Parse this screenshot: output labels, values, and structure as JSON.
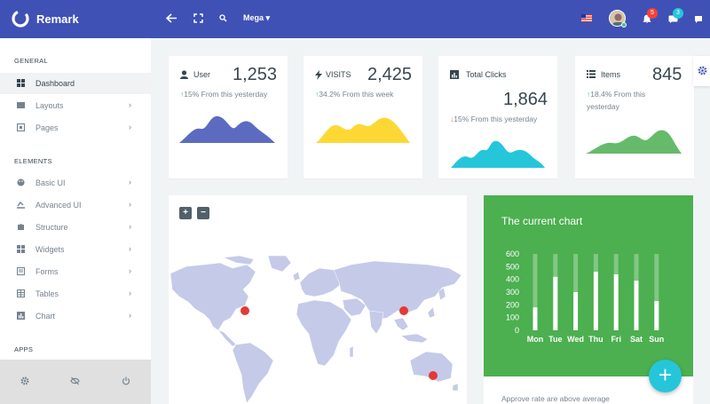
{
  "brand": {
    "name": "Remark"
  },
  "navbar": {
    "mega_label": "Mega",
    "badges": {
      "notifications": "5",
      "messages": "3"
    },
    "accent": "#3f51b5"
  },
  "sidebar": {
    "sections": [
      {
        "title": "GENERAL",
        "items": [
          {
            "label": "Dashboard",
            "icon": "dashboard-icon",
            "active": true,
            "arrow": false
          },
          {
            "label": "Layouts",
            "icon": "layouts-icon",
            "arrow": true
          },
          {
            "label": "Pages",
            "icon": "pages-icon",
            "arrow": true
          }
        ]
      },
      {
        "title": "ELEMENTS",
        "items": [
          {
            "label": "Basic UI",
            "icon": "palette-icon",
            "arrow": true
          },
          {
            "label": "Advanced UI",
            "icon": "advanced-icon",
            "arrow": true
          },
          {
            "label": "Structure",
            "icon": "puzzle-icon",
            "arrow": true
          },
          {
            "label": "Widgets",
            "icon": "widgets-icon",
            "arrow": true
          },
          {
            "label": "Forms",
            "icon": "forms-icon",
            "arrow": true
          },
          {
            "label": "Tables",
            "icon": "table-icon",
            "arrow": true
          },
          {
            "label": "Chart",
            "icon": "chart-icon",
            "arrow": true
          }
        ]
      },
      {
        "title": "APPS",
        "items": []
      }
    ]
  },
  "stats": [
    {
      "label": "User",
      "value": "1,253",
      "arrow": "↑",
      "trend": "15% From this yesterday",
      "direction": "up",
      "color": "#5c6bc0",
      "icon": "user-icon"
    },
    {
      "label": "VISITS",
      "value": "2,425",
      "arrow": "↑",
      "trend": "34.2% From this week",
      "direction": "up",
      "color": "#fdd835",
      "icon": "bolt-icon"
    },
    {
      "label": "Total Clicks",
      "value": "1,864",
      "arrow": "↓",
      "trend": "15% From this yesterday",
      "direction": "down",
      "color": "#26c6da",
      "icon": "bar-chart-icon"
    },
    {
      "label": "Items",
      "value": "845",
      "arrow": "↑",
      "trend_line1": "18.4% From this",
      "trend_line2": "yesterday",
      "direction": "up",
      "color": "#66bb6a",
      "icon": "list-icon"
    }
  ],
  "map": {
    "zoom_in": "+",
    "zoom_out": "−",
    "marker_color": "#e53935"
  },
  "chart_data": {
    "type": "bar",
    "title": "The current chart",
    "categories": [
      "Mon",
      "Tue",
      "Wed",
      "Thu",
      "Fri",
      "Sat",
      "Sun"
    ],
    "ylim": [
      0,
      600
    ],
    "yticks": [
      "0",
      "100",
      "200",
      "300",
      "400",
      "500",
      "600"
    ],
    "series": [
      {
        "values": [
          180,
          420,
          300,
          460,
          440,
          390,
          230
        ]
      }
    ],
    "note": "Approve rate are above average"
  },
  "fab": {
    "label": "+"
  }
}
